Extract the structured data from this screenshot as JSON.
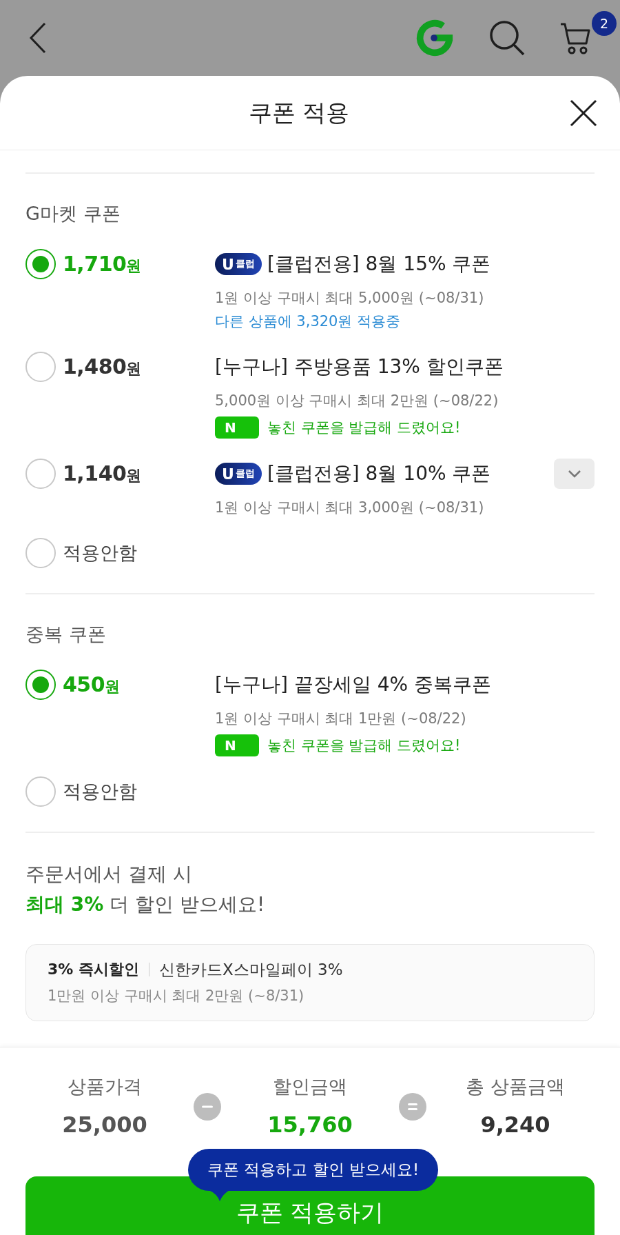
{
  "top_bar": {
    "cart_count": "2"
  },
  "sheet": {
    "title": "쿠폰 적용"
  },
  "sections": [
    {
      "heading": "G마켓 쿠폰",
      "options": [
        {
          "kind": "coupon",
          "selected": true,
          "amount": "1,710",
          "unit": "원",
          "badge": {
            "mark": "U",
            "label": "클럽"
          },
          "title": "[클럽전용] 8월 15% 쿠폰",
          "condition": "1원 이상 구매시 최대 5,000원 (~08/31)",
          "note": {
            "kind": "applied",
            "text": "다른 상품에 3,320원 적용중"
          }
        },
        {
          "kind": "coupon",
          "selected": false,
          "amount": "1,480",
          "unit": "원",
          "title": "[누구나] 주방용품 13% 할인쿠폰",
          "condition": "5,000원 이상 구매시 최대 2만원 (~08/22)",
          "note": {
            "kind": "reissued",
            "badge": "N",
            "text": "놓친 쿠폰을 발급해 드렸어요!"
          }
        },
        {
          "kind": "coupon",
          "selected": false,
          "amount": "1,140",
          "unit": "원",
          "badge": {
            "mark": "U",
            "label": "클럽"
          },
          "title": "[클럽전용] 8월 10% 쿠폰",
          "condition": "1원 이상 구매시 최대 3,000원 (~08/31)",
          "more": {
            "expanded": false
          }
        },
        {
          "kind": "none",
          "selected": false,
          "label": "적용안함"
        }
      ]
    },
    {
      "heading": "중복 쿠폰",
      "options": [
        {
          "kind": "coupon",
          "selected": true,
          "amount": "450",
          "unit": "원",
          "title": "[누구나] 끝장세일 4% 중복쿠폰",
          "condition": "1원 이상 구매시 최대 1만원 (~08/22)",
          "note": {
            "kind": "reissued",
            "badge": "N",
            "text": "놓친 쿠폰을 발급해 드렸어요!"
          }
        },
        {
          "kind": "none",
          "selected": false,
          "label": "적용안함"
        }
      ]
    }
  ],
  "payment_promo": {
    "lines": [
      "주문서에서 결제 시",
      "**최대 3%** 더 할인 받으세요!"
    ],
    "offer": {
      "tag": "3% 즉시할인",
      "title": "신한카드X스마일페이 3%",
      "condition": "1만원 이상 구매시 최대 2만원 (~8/31)"
    }
  },
  "summary": {
    "items": [
      {
        "kind": "price",
        "label": "상품가격",
        "value": "25,000"
      },
      {
        "kind": "discount",
        "label": "할인금액",
        "value": "15,760"
      },
      {
        "kind": "total",
        "label": "총 상품금액",
        "value": "9,240"
      }
    ]
  },
  "tooltip": "쿠폰 적용하고 할인 받으세요!",
  "apply_button": "쿠폰 적용하기"
}
